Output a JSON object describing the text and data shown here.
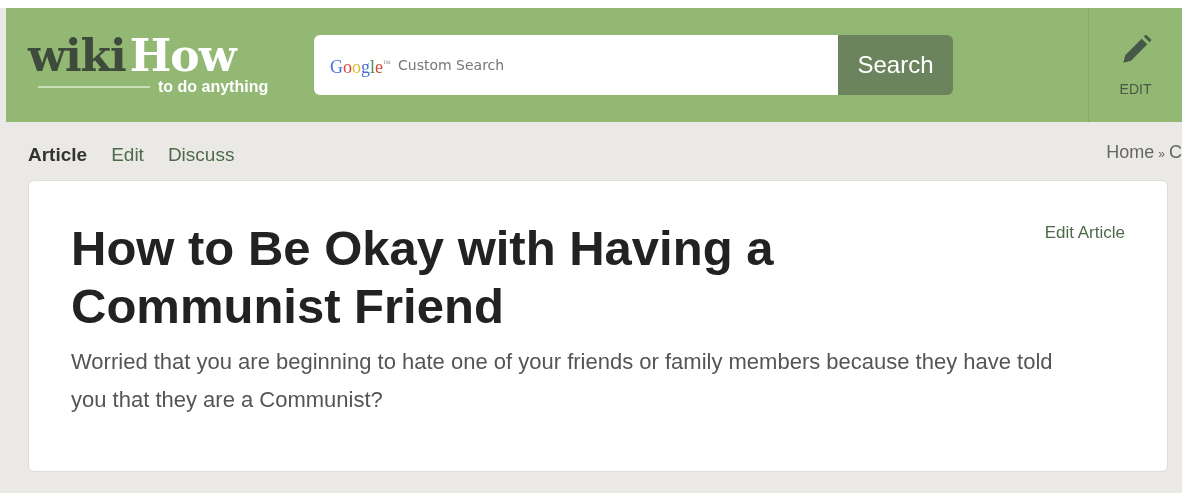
{
  "header": {
    "logo": {
      "part_1": "wiki",
      "part_2": "How",
      "tagline": "to do anything"
    },
    "search": {
      "logo": "Google",
      "logo_mark": "™",
      "placeholder": "Custom Search",
      "button": "Search"
    },
    "edit_button": "EDIT"
  },
  "tabs": [
    {
      "label": "Article",
      "selected": true
    },
    {
      "label": "Edit",
      "selected": false
    },
    {
      "label": "Discuss",
      "selected": false
    }
  ],
  "breadcrumb": {
    "items": [
      "Home",
      "C"
    ],
    "separator": "»"
  },
  "article": {
    "edit_link": "Edit Article",
    "title": "How to Be Okay with Having a Communist Friend",
    "intro": "Worried that you are beginning to hate one of your friends or family members because they have told you that they are a Communist?"
  }
}
